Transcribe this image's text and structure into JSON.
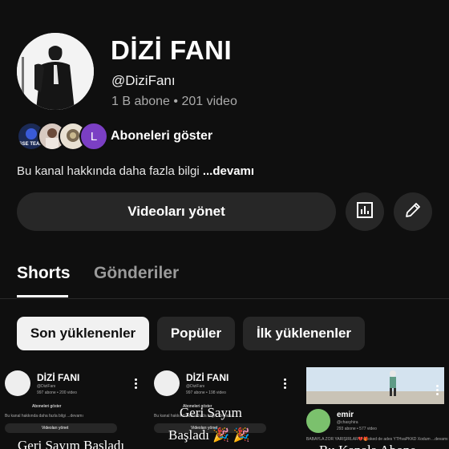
{
  "channel": {
    "title": "DİZİ FANI",
    "handle": "@DiziFanı",
    "stats": "1 B abone • 201 video",
    "subscribers_label": "Aboneleri göster",
    "subscriber_avatar_letter": "L",
    "subscriber_badge_text": "SSE TEAM",
    "about_text": "Bu kanal hakkında daha fazla bilgi",
    "about_more": "...devamı"
  },
  "actions": {
    "manage_videos": "Videoları yönet",
    "analytics_icon": "bar-chart-icon",
    "edit_icon": "pencil-icon"
  },
  "tabs": [
    {
      "label": "Shorts",
      "active": true
    },
    {
      "label": "Gönderiler",
      "active": false
    }
  ],
  "filters": [
    {
      "label": "Son yüklenenler",
      "active": true
    },
    {
      "label": "Popüler",
      "active": false
    },
    {
      "label": "İlk yüklenenler",
      "active": false
    }
  ],
  "shorts": [
    {
      "mini_title": "DİZİ FANI",
      "mini_handle": "@DiziFanı",
      "mini_stats": "997 abone • 200 video",
      "mini_subs": "Aboneleri göster",
      "mini_about": "Bu kanal hakkında daha fazla bilgi ...devamı",
      "mini_button": "Videoları yönet",
      "overlay": "Geri Sayım Başladı"
    },
    {
      "mini_title": "DİZİ FANI",
      "mini_handle": "@DiziFanı",
      "mini_stats": "997 abone • 198 video",
      "mini_subs": "Aboneleri göster",
      "mini_about": "Bu kanal hakkında daha fazla bilgi ...devamı",
      "mini_button": "Videoları yönet",
      "overlay_line1": "Geri Sayım",
      "overlay_line2": "Başladı 🎉 🎉"
    },
    {
      "mini_title": "emir",
      "mini_handle": "@chasyhira",
      "mini_stats": "293 abone • 577 video",
      "mini_desc": "BABAYLA ZOR YARIŞIRLAR💔🎁oked de ades YTHvaPKKD Xodum ...devamı",
      "overlay": "Bu Kanala Abone"
    }
  ]
}
